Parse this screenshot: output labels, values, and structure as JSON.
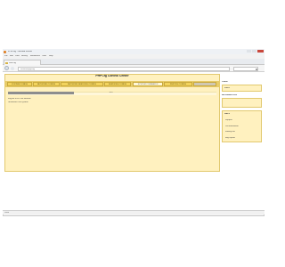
{
  "browser": {
    "window_title": "PHPCfg - Mozilla Firefox",
    "menu": [
      "File",
      "Edit",
      "View",
      "History",
      "Bookmarks",
      "Tools",
      "Help"
    ],
    "tab_title": "PHPCfg",
    "url": "localhost/phpcfg/"
  },
  "app": {
    "title": "PHPCfg Control Center",
    "tabs": [
      {
        "label": "SYSTEM CONFIG",
        "state": "normal"
      },
      {
        "label": "NETWORK CONFIG",
        "state": "normal"
      },
      {
        "label": "NETWORK SERVICES CONFIG",
        "state": "normal"
      },
      {
        "label": "SERVICES CONFIG",
        "state": "normal"
      },
      {
        "label": "SYSTEM COMMANDS",
        "state": "active"
      },
      {
        "label": "PHPCFG CONFIG",
        "state": "normal"
      },
      {
        "label": "",
        "state": "grey"
      }
    ],
    "content": {
      "header": "EXIT",
      "lines": [
        "Logout from this session",
        "Shutdown the system"
      ]
    }
  },
  "sidebar": {
    "box1": {
      "title": "USER",
      "value": "admin"
    },
    "box2": {
      "title": "INFORMATION",
      "value": ""
    },
    "box3": {
      "title": "HELP",
      "items": [
        "Support",
        "Documentation",
        "Mailing lists",
        "Bug reports"
      ]
    }
  },
  "status": {
    "text": "Done"
  },
  "colors": {
    "panel": "#fff1bf",
    "tab": "#f2d35e",
    "border": "#e2c96f"
  }
}
